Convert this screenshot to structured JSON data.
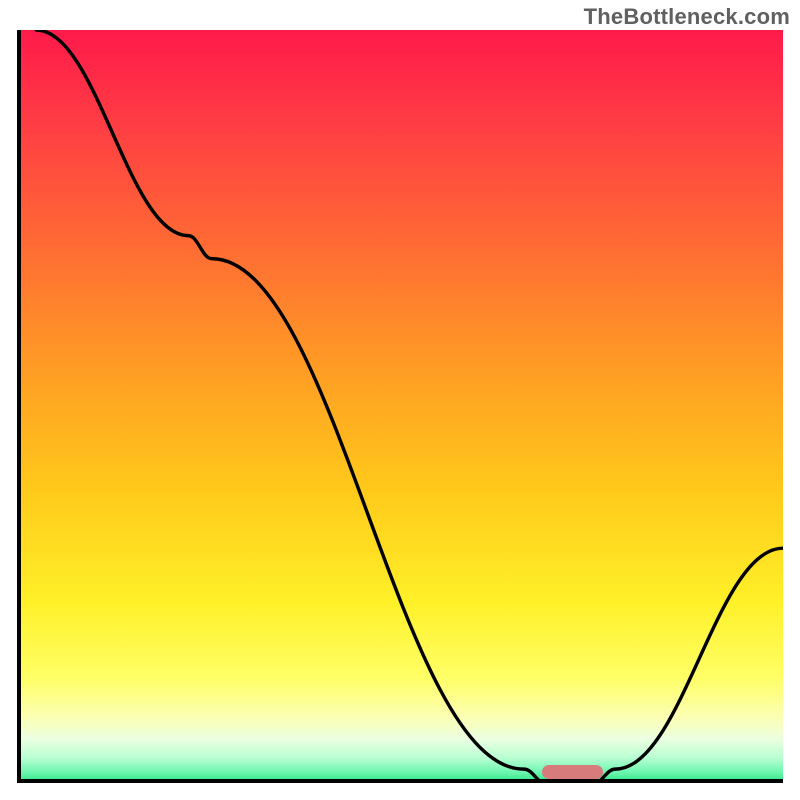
{
  "watermark": "TheBottleneck.com",
  "colors": {
    "text_gray": "#606060",
    "curve_stroke": "#000000",
    "marker_fill": "#d87b7d",
    "axis_black": "#000000"
  },
  "gradient_stops": [
    {
      "offset": 0.0,
      "color": "#ff1a4a"
    },
    {
      "offset": 0.12,
      "color": "#ff3c44"
    },
    {
      "offset": 0.28,
      "color": "#ff6a34"
    },
    {
      "offset": 0.45,
      "color": "#ff9e24"
    },
    {
      "offset": 0.6,
      "color": "#ffc81a"
    },
    {
      "offset": 0.75,
      "color": "#fff028"
    },
    {
      "offset": 0.85,
      "color": "#ffff66"
    },
    {
      "offset": 0.9,
      "color": "#fcffb0"
    },
    {
      "offset": 0.93,
      "color": "#ecffe0"
    },
    {
      "offset": 0.955,
      "color": "#b9ffd2"
    },
    {
      "offset": 0.975,
      "color": "#69f5ad"
    },
    {
      "offset": 0.99,
      "color": "#20e07c"
    },
    {
      "offset": 1.0,
      "color": "#12d26c"
    }
  ],
  "chart_data": {
    "type": "line",
    "title": "",
    "xlabel": "",
    "ylabel": "",
    "xlim": [
      0,
      100
    ],
    "ylim": [
      0,
      100
    ],
    "points": [
      {
        "x": 2,
        "y": 100
      },
      {
        "x": 22,
        "y": 73
      },
      {
        "x": 25,
        "y": 70
      },
      {
        "x": 66,
        "y": 3
      },
      {
        "x": 69,
        "y": 1
      },
      {
        "x": 75,
        "y": 1
      },
      {
        "x": 78,
        "y": 3
      },
      {
        "x": 100,
        "y": 32
      }
    ],
    "marker": {
      "x_start": 68,
      "x_end": 76,
      "y": 1.5
    },
    "note": "x and y are in percent of plot area; y measured from bottom; values estimated from pixel positions"
  }
}
